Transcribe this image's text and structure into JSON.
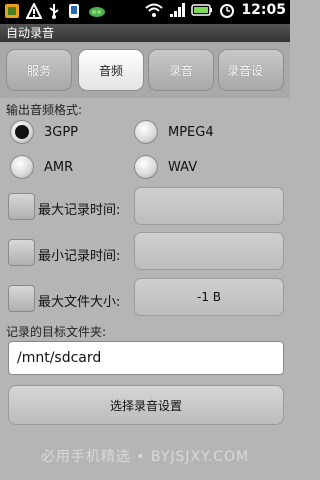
{
  "status_bar": {
    "time": "12:05",
    "left_icons": [
      "notification-app-icon",
      "warning-icon",
      "usb-icon",
      "phone-icon",
      "pea-icon"
    ],
    "right_icons": [
      "wifi-icon",
      "signal-icon",
      "battery-icon",
      "alarm-icon"
    ]
  },
  "app": {
    "title": "自动录音"
  },
  "tabs": [
    {
      "label": "服务",
      "active": false
    },
    {
      "label": "音频",
      "active": true
    },
    {
      "label": "录音",
      "active": false
    },
    {
      "label": "录音设",
      "active": false
    }
  ],
  "audio_format": {
    "heading": "输出音频格式:",
    "options": [
      {
        "label": "3GPP",
        "selected": true
      },
      {
        "label": "MPEG4",
        "selected": false
      },
      {
        "label": "AMR",
        "selected": false
      },
      {
        "label": "WAV",
        "selected": false
      }
    ]
  },
  "settings": {
    "max_time_label": "最大记录时间:",
    "max_time_value": "",
    "min_time_label": "最小记录时间:",
    "min_time_value": "",
    "max_size_label": "最大文件大小:",
    "max_size_value": "-1 B"
  },
  "target_folder": {
    "label": "记录的目标文件夹:",
    "value": "/mnt/sdcard"
  },
  "actions": {
    "select_settings": "选择录音设置"
  },
  "watermark": "必用手机精选 • BYJSJXY.COM"
}
